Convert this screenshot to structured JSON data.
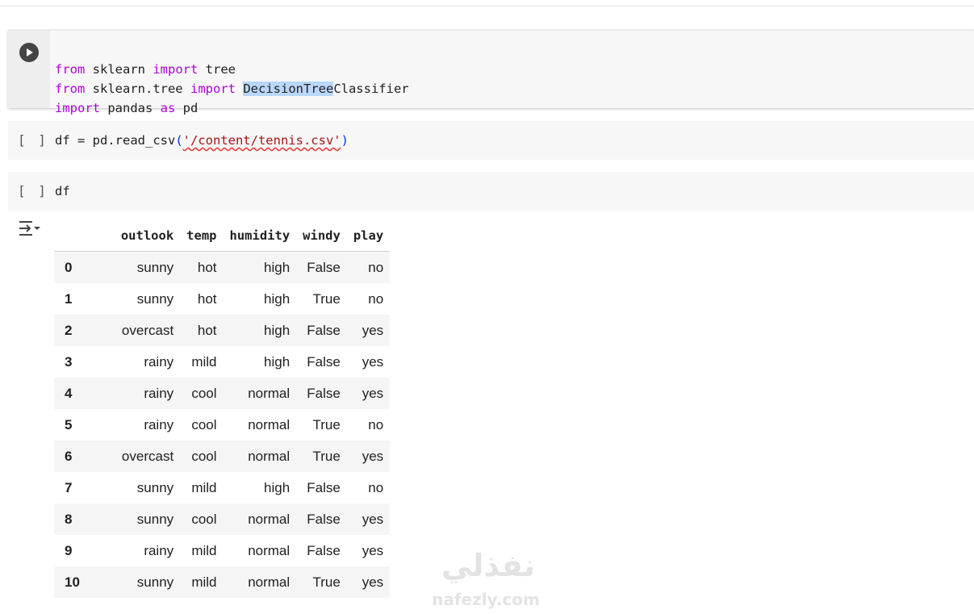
{
  "cells": [
    {
      "id": "import-cell",
      "lines": [
        [
          "from",
          " sklearn ",
          "import",
          " tree"
        ],
        [
          "from",
          " sklearn.tree ",
          "import",
          " ",
          "DecisionTree",
          "Classifier"
        ],
        [
          "import",
          " pandas ",
          "as",
          " pd"
        ]
      ]
    },
    {
      "id": "read-csv-cell",
      "bracket": "[ ]",
      "code_pre": "df = pd.read_csv",
      "paren_open": "(",
      "string": "'/content/tennis.csv'",
      "paren_close": ")"
    },
    {
      "id": "df-cell",
      "bracket": "[ ]",
      "code": "df"
    }
  ],
  "dataframe": {
    "columns": [
      "outlook",
      "temp",
      "humidity",
      "windy",
      "play"
    ],
    "rows": [
      {
        "index": "0",
        "outlook": "sunny",
        "temp": "hot",
        "humidity": "high",
        "windy": "False",
        "play": "no"
      },
      {
        "index": "1",
        "outlook": "sunny",
        "temp": "hot",
        "humidity": "high",
        "windy": "True",
        "play": "no"
      },
      {
        "index": "2",
        "outlook": "overcast",
        "temp": "hot",
        "humidity": "high",
        "windy": "False",
        "play": "yes"
      },
      {
        "index": "3",
        "outlook": "rainy",
        "temp": "mild",
        "humidity": "high",
        "windy": "False",
        "play": "yes"
      },
      {
        "index": "4",
        "outlook": "rainy",
        "temp": "cool",
        "humidity": "normal",
        "windy": "False",
        "play": "yes"
      },
      {
        "index": "5",
        "outlook": "rainy",
        "temp": "cool",
        "humidity": "normal",
        "windy": "True",
        "play": "no"
      },
      {
        "index": "6",
        "outlook": "overcast",
        "temp": "cool",
        "humidity": "normal",
        "windy": "True",
        "play": "yes"
      },
      {
        "index": "7",
        "outlook": "sunny",
        "temp": "mild",
        "humidity": "high",
        "windy": "False",
        "play": "no"
      },
      {
        "index": "8",
        "outlook": "sunny",
        "temp": "cool",
        "humidity": "normal",
        "windy": "False",
        "play": "yes"
      },
      {
        "index": "9",
        "outlook": "rainy",
        "temp": "mild",
        "humidity": "normal",
        "windy": "False",
        "play": "yes"
      },
      {
        "index": "10",
        "outlook": "sunny",
        "temp": "mild",
        "humidity": "normal",
        "windy": "True",
        "play": "yes"
      }
    ]
  },
  "watermark": {
    "arabic": "نفذلي",
    "latin": "nafezly.com"
  },
  "icons": {
    "run": "play-circle-icon",
    "output": "output-toggle-icon"
  }
}
